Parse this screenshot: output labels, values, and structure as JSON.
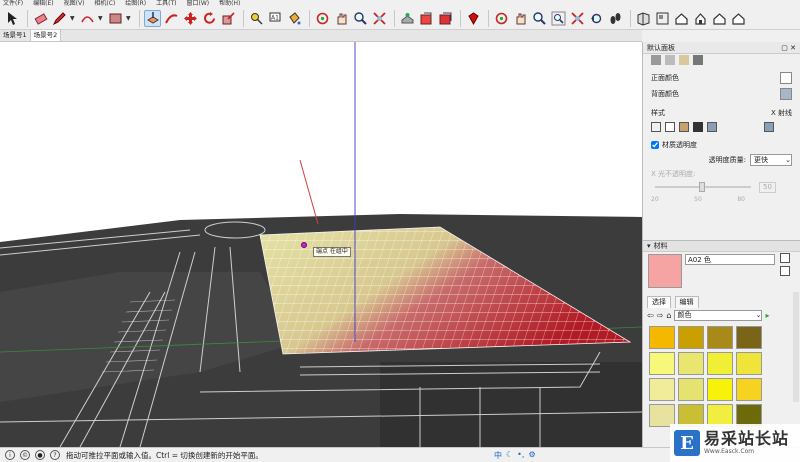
{
  "menu": [
    "文件(F)",
    "编辑(E)",
    "视图(V)",
    "相机(C)",
    "绘图(R)",
    "工具(T)",
    "窗口(W)",
    "帮助(H)"
  ],
  "scene_tabs": [
    "场景号1",
    "场景号2"
  ],
  "active_scene_tab": 1,
  "viewport": {
    "tooltip": "端点 在组中"
  },
  "panel": {
    "title": "默认面板",
    "front_color_label": "正面颜色",
    "back_color_label": "背面颜色",
    "front_color": "#ffffff",
    "back_color": "#a7b6c8",
    "style_label": "样式",
    "xray_label": "X 射线",
    "material_transparency_label": "材质透明度",
    "transparency_quality_label": "透明度质量:",
    "transparency_quality_value": "更快",
    "opacity_label": "X 光不透明度:",
    "slider_ticks": [
      "20",
      "50",
      "80"
    ],
    "slider_value": "50",
    "materials_title": "材料",
    "material_name": "A02 色",
    "material_color": "#f5a3a3",
    "tab_select": "选择",
    "tab_edit": "编辑",
    "library_dropdown": "颜色",
    "swatches": [
      "#f5b800",
      "#caa000",
      "#a88a1a",
      "#7a6418",
      "#f7f77a",
      "#e8e66e",
      "#eff036",
      "#eee43a",
      "#f1ec9a",
      "#e6e270",
      "#f7f20a",
      "#f5d320",
      "#e8e2a0",
      "#cabf34",
      "#f1ee40",
      "#6d6a0c"
    ]
  },
  "status": {
    "message": "拖动可推拉平面或输入值。Ctrl = 切换创建新的开始平面。",
    "ime_mode": "中"
  },
  "watermark": {
    "logo": "E",
    "main": "易采站长站",
    "sub": "Www.Easck.Com"
  }
}
